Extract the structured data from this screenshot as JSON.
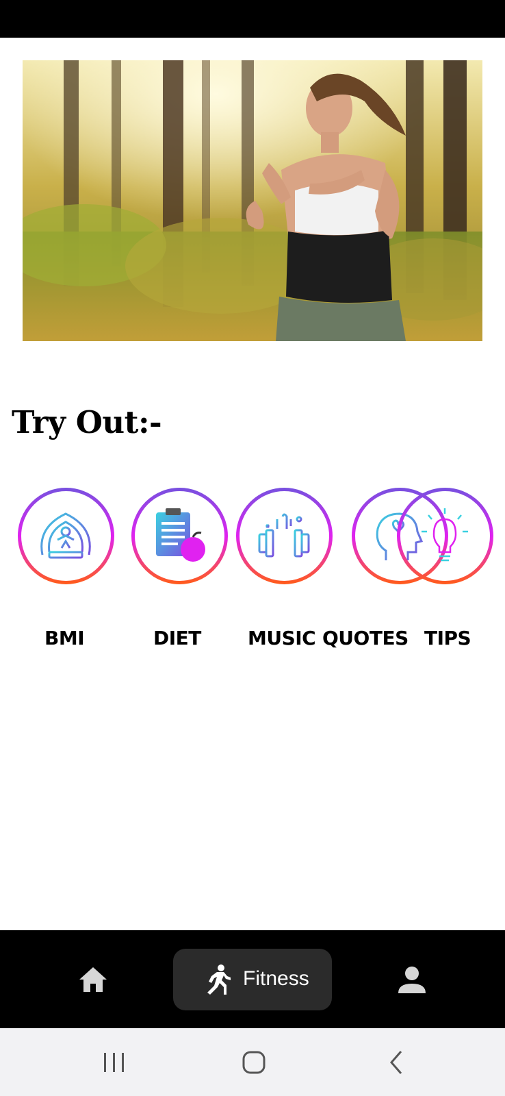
{
  "hero": {
    "image": "woman-running-in-forest-photo"
  },
  "section": {
    "title": "Try Out:-"
  },
  "features": [
    {
      "label": "BMI",
      "icon": "bmi-scale-icon"
    },
    {
      "label": "DIET",
      "icon": "diet-clipboard-apple-icon"
    },
    {
      "label": "MUSIC",
      "icon": "music-dumbbell-headphones-icon"
    },
    {
      "label": "QUOTES",
      "icon": "quotes-head-heart-icon"
    },
    {
      "label": "TIPS",
      "icon": "tips-lightbulb-icon"
    }
  ],
  "bottom_nav": {
    "home_icon": "home-icon",
    "active_label": "Fitness",
    "active_icon": "running-person-icon",
    "profile_icon": "person-icon"
  },
  "system_nav": {
    "recents_icon": "recents-icon",
    "home_icon": "home-circle-icon",
    "back_icon": "back-chevron-icon"
  },
  "colors": {
    "ring_top": "#7a4fe0",
    "ring_mid": "#e022f0",
    "ring_bottom": "#ff5a1f",
    "nav_bg": "#000000",
    "nav_active_bg": "#2b2b2b"
  }
}
